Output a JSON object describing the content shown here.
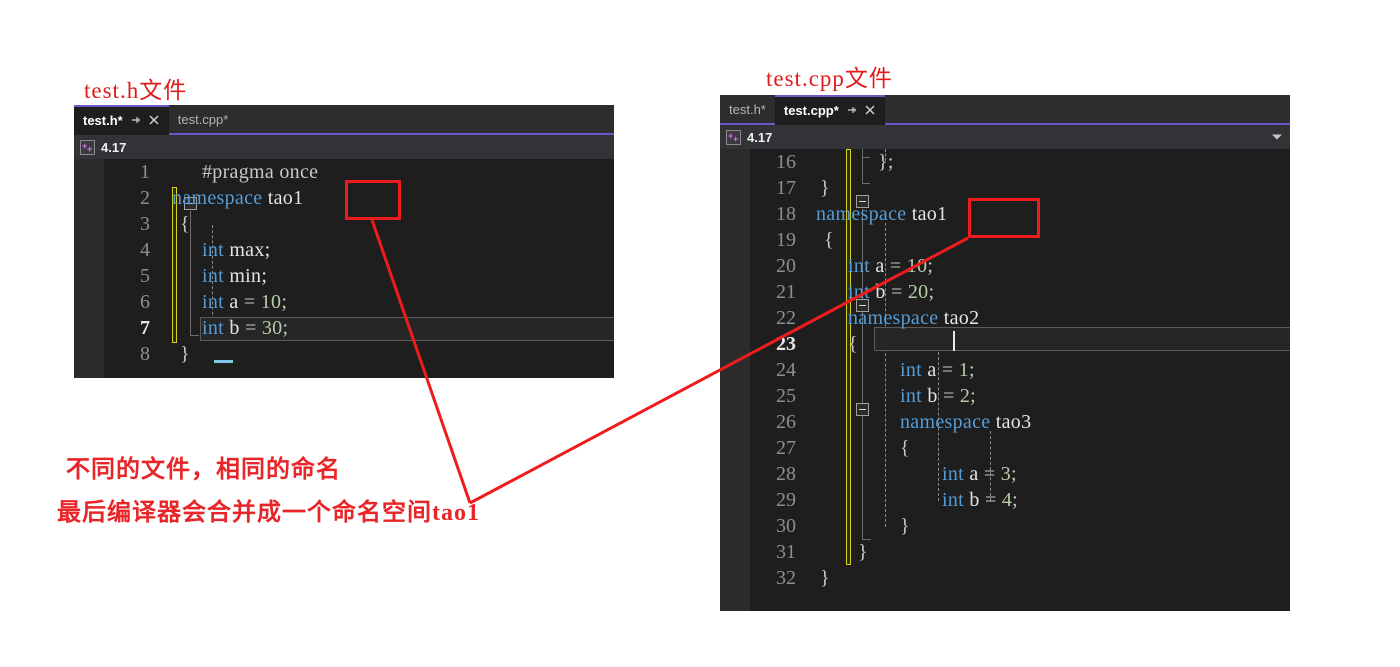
{
  "captions": {
    "left": "test.h文件",
    "right": "test.cpp文件"
  },
  "notes": {
    "line1": "不同的文件，相同的命名",
    "line2": "最后编译器会合并成一个命名空间tao1"
  },
  "colors": {
    "annotation_red": "#ee1c1c",
    "note_red": "#e8262a",
    "tab_underline_purple": "#6f55c6",
    "editor_bg": "#1e1e1e",
    "keyword_blue": "#569cd6",
    "number_green": "#b5cea8",
    "changebar_yellow": "#d7d21a"
  },
  "left_editor": {
    "tabs": [
      {
        "label": "test.h*",
        "active": true,
        "pin_icon": "pin-icon",
        "close_icon": "close-icon"
      },
      {
        "label": "test.cpp*",
        "active": false
      }
    ],
    "navbar": {
      "icon": "cpp-file-icon",
      "text": "4.17",
      "caret": "chevron-down-icon"
    },
    "lines": [
      {
        "no": "1",
        "text": "#pragma once"
      },
      {
        "no": "2",
        "text": "namespace tao1"
      },
      {
        "no": "3",
        "text": "{"
      },
      {
        "no": "4",
        "text": "int max;"
      },
      {
        "no": "5",
        "text": "int min;"
      },
      {
        "no": "6",
        "text": "int a = 10;"
      },
      {
        "no": "7",
        "text": "int b = 30;"
      },
      {
        "no": "8",
        "text": "}"
      }
    ],
    "current_line": "7",
    "highlight_token": "tao1"
  },
  "right_editor": {
    "tabs": [
      {
        "label": "test.h*",
        "active": false
      },
      {
        "label": "test.cpp*",
        "active": true,
        "pin_icon": "pin-icon",
        "close_icon": "close-icon"
      }
    ],
    "navbar": {
      "icon": "cpp-file-icon",
      "text": "4.17",
      "caret": "chevron-down-icon"
    },
    "lines": [
      {
        "no": "16",
        "text": "};"
      },
      {
        "no": "17",
        "text": "}"
      },
      {
        "no": "18",
        "text": "namespace tao1"
      },
      {
        "no": "19",
        "text": "{"
      },
      {
        "no": "20",
        "text": "int a = 10;"
      },
      {
        "no": "21",
        "text": "int b = 20;"
      },
      {
        "no": "22",
        "text": "namespace tao2"
      },
      {
        "no": "23",
        "text": "{"
      },
      {
        "no": "24",
        "text": "int a = 1;"
      },
      {
        "no": "25",
        "text": "int b = 2;"
      },
      {
        "no": "26",
        "text": "namespace tao3"
      },
      {
        "no": "27",
        "text": "{"
      },
      {
        "no": "28",
        "text": "int a = 3;"
      },
      {
        "no": "29",
        "text": "int b = 4;"
      },
      {
        "no": "30",
        "text": "}"
      },
      {
        "no": "31",
        "text": "}"
      },
      {
        "no": "32",
        "text": "}"
      }
    ],
    "current_line": "23",
    "highlight_token": "tao1"
  },
  "code_tokens": {
    "pragma": "#pragma once",
    "namespace": "namespace",
    "tao1": "tao1",
    "tao2": "tao2",
    "tao3": "tao3",
    "int": "int",
    "brace_open": "{",
    "brace_close": "}",
    "brace_close_semi": "};",
    "max_decl": "max;",
    "min_decl": "min;",
    "a": "a",
    "b": "b",
    "eq": "=",
    "semi": ";",
    "n10": "10",
    "n20": "20",
    "n30": "30",
    "n1": "1",
    "n2": "2",
    "n3": "3",
    "n4": "4"
  }
}
